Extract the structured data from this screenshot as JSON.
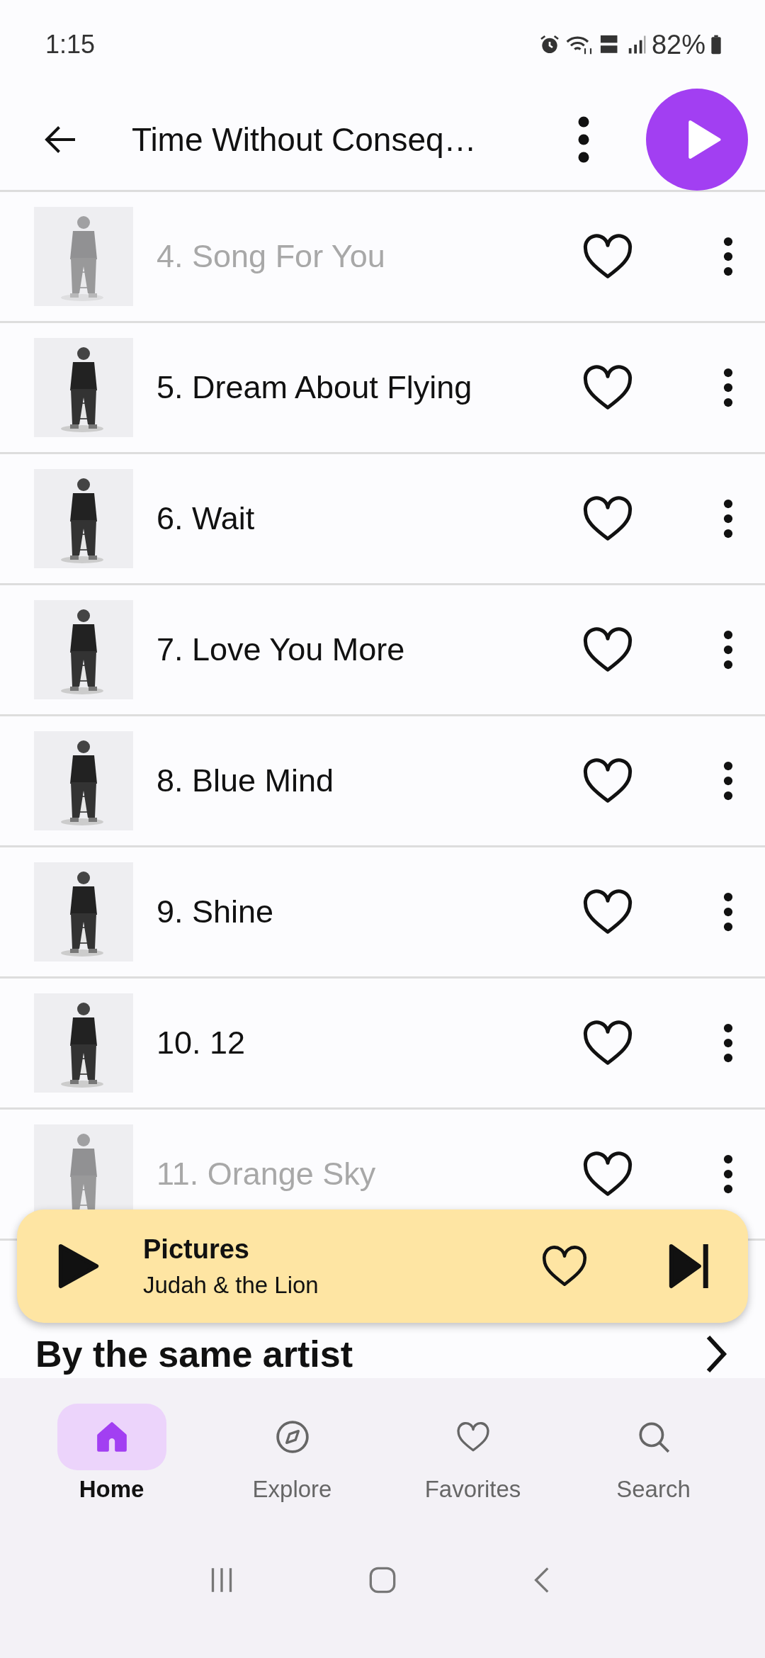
{
  "status_bar": {
    "time": "1:15",
    "battery": "82%"
  },
  "header": {
    "title": "Time Without Conseq…"
  },
  "tracks": [
    {
      "title": "4. Song For You",
      "dimmed": true,
      "favorite": false
    },
    {
      "title": "5. Dream About Flying",
      "dimmed": false,
      "favorite": false
    },
    {
      "title": "6. Wait",
      "dimmed": false,
      "favorite": false
    },
    {
      "title": "7. Love You More",
      "dimmed": false,
      "favorite": false
    },
    {
      "title": "8. Blue Mind",
      "dimmed": false,
      "favorite": false
    },
    {
      "title": "9. Shine",
      "dimmed": false,
      "favorite": false
    },
    {
      "title": "10. 12",
      "dimmed": false,
      "favorite": false
    },
    {
      "title": "11. Orange Sky",
      "dimmed": true,
      "favorite": false
    }
  ],
  "section_heading": "By the same artist",
  "mini_player": {
    "title": "Pictures",
    "artist": "Judah & the Lion",
    "favorite": false
  },
  "nav": [
    {
      "label": "Home",
      "kind": "home",
      "selected": true
    },
    {
      "label": "Explore",
      "kind": "explore",
      "selected": false
    },
    {
      "label": "Favorites",
      "kind": "favorites",
      "selected": false
    },
    {
      "label": "Search",
      "kind": "search",
      "selected": false
    }
  ]
}
